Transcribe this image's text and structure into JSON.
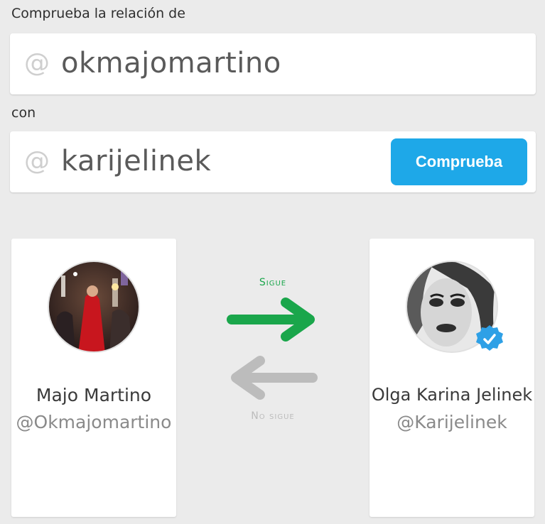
{
  "form": {
    "check_label": "Comprueba la relación de",
    "with_label": "con",
    "at_symbol": "@",
    "user1_value": "okmajomartino",
    "user2_value": "karijelinek",
    "check_button": "Comprueba"
  },
  "relationship": {
    "follows_label": "Sigue",
    "not_follows_label": "No sigue",
    "follows_color": "#1aa64b",
    "not_follows_color": "#bcbcbc"
  },
  "profiles": [
    {
      "name": "Majo Martino",
      "handle": "@Okmajomartino",
      "verified": false
    },
    {
      "name": "Olga Karina Jelinek",
      "handle": "@Karijelinek",
      "verified": true
    }
  ],
  "colors": {
    "accent": "#1ea8e8",
    "background": "#ebebeb"
  }
}
